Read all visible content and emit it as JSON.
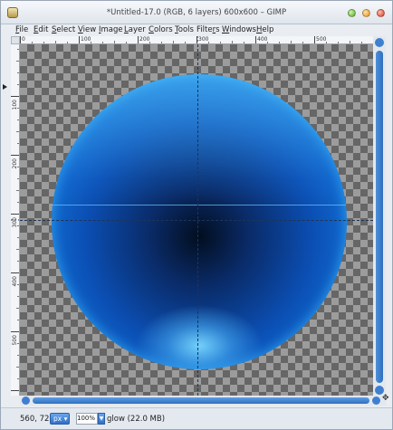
{
  "window": {
    "title": "*Untitled-17.0 (RGB, 6 layers) 600x600 – GIMP"
  },
  "menu": [
    {
      "name": "file",
      "pre": "",
      "u": "F",
      "rest": "ile"
    },
    {
      "name": "edit",
      "pre": "",
      "u": "E",
      "rest": "dit"
    },
    {
      "name": "select",
      "pre": "",
      "u": "S",
      "rest": "elect"
    },
    {
      "name": "view",
      "pre": "",
      "u": "V",
      "rest": "iew"
    },
    {
      "name": "image",
      "pre": "",
      "u": "I",
      "rest": "mage"
    },
    {
      "name": "layer",
      "pre": "",
      "u": "L",
      "rest": "ayer"
    },
    {
      "name": "colors",
      "pre": "",
      "u": "C",
      "rest": "olors"
    },
    {
      "name": "tools",
      "pre": "",
      "u": "T",
      "rest": "ools"
    },
    {
      "name": "filters",
      "pre": "Filte",
      "u": "r",
      "rest": "s"
    },
    {
      "name": "windows",
      "pre": "",
      "u": "W",
      "rest": "indows"
    },
    {
      "name": "help",
      "pre": "",
      "u": "H",
      "rest": "elp"
    }
  ],
  "ruler": {
    "horizontal_labels": [
      "0",
      "100",
      "200",
      "300",
      "400",
      "500"
    ],
    "vertical_labels": [
      "100",
      "200",
      "300",
      "400",
      "500"
    ]
  },
  "icons": {
    "app": "gimp-app-icon",
    "minimize": "minimize-icon",
    "maximize": "maximize-icon",
    "close": "close-icon",
    "navigate": "navigate-icon"
  },
  "status": {
    "coordinates": "560, 72",
    "unit": "px",
    "zoom": "100%",
    "message": "glow (22.0 MB)"
  },
  "colors": {
    "accent": "#2f6fc4",
    "sphere_core": "#020e1f",
    "sphere_edge": "#2aa4f4"
  }
}
